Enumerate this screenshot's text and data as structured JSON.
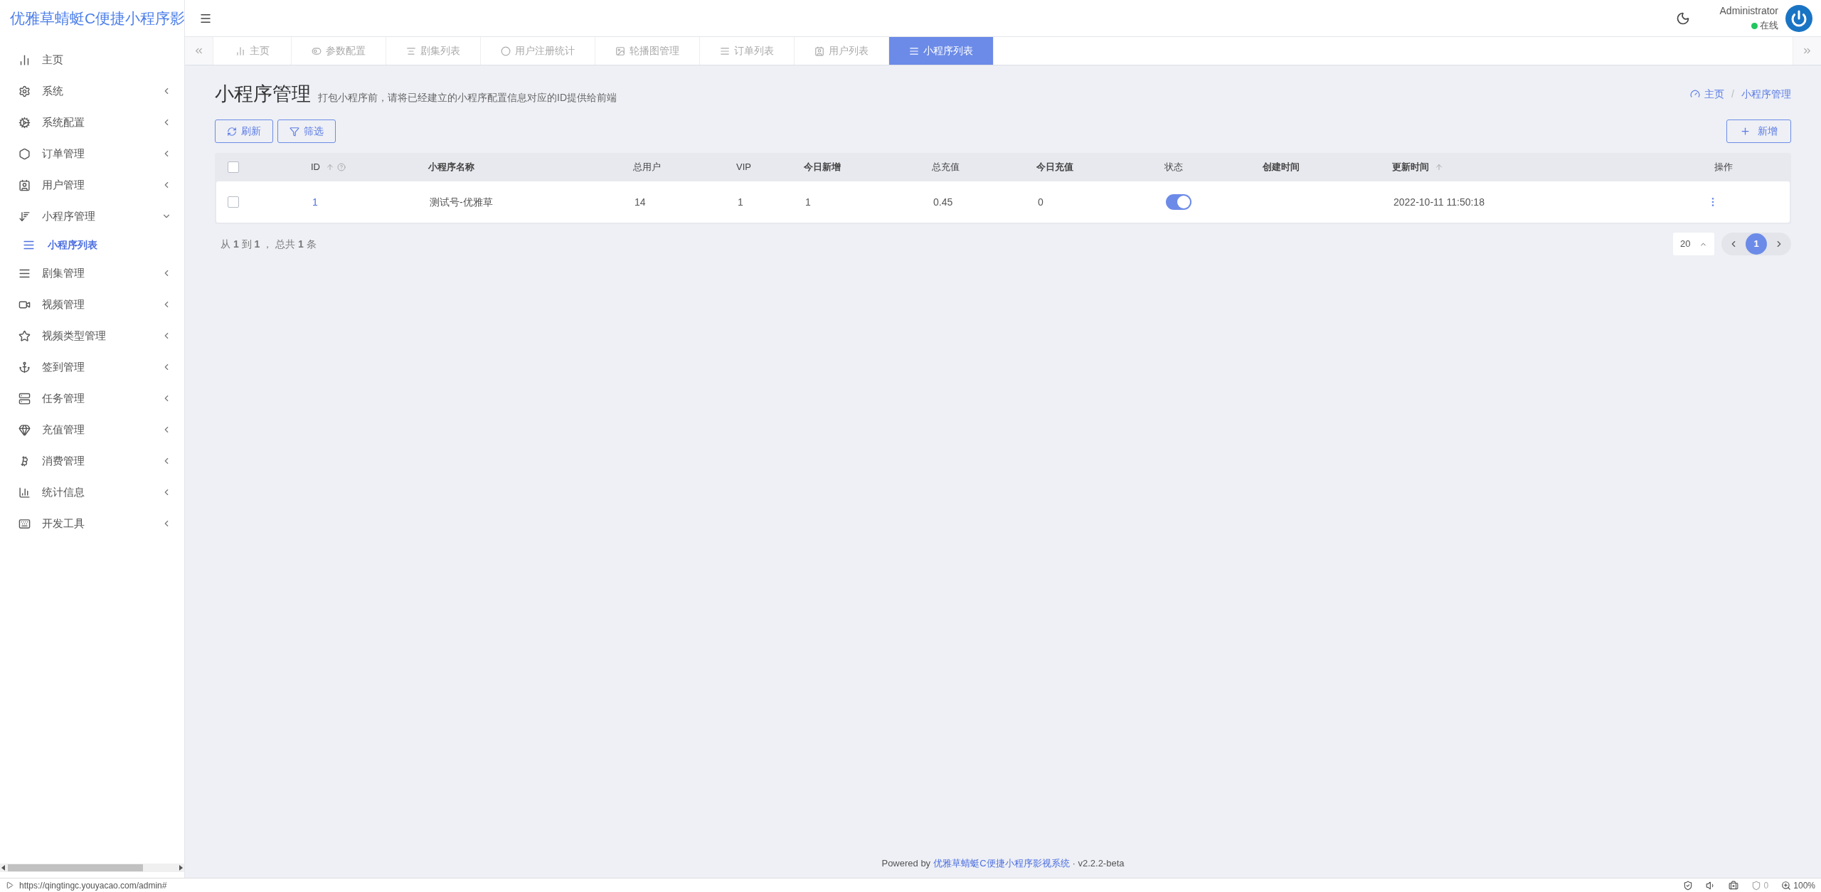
{
  "sidebar": {
    "logo": "优雅草蜻蜓C便捷小程序影",
    "items": [
      {
        "label": "主页",
        "kind": "link"
      },
      {
        "label": "系统",
        "kind": "menu",
        "expanded": false
      },
      {
        "label": "系统配置",
        "kind": "menu",
        "expanded": false
      },
      {
        "label": "订单管理",
        "kind": "menu",
        "expanded": false
      },
      {
        "label": "用户管理",
        "kind": "menu",
        "expanded": false
      },
      {
        "label": "小程序管理",
        "kind": "menu",
        "expanded": true,
        "children": [
          {
            "label": "小程序列表",
            "selected": true
          }
        ]
      },
      {
        "label": "剧集管理",
        "kind": "menu",
        "expanded": false
      },
      {
        "label": "视频管理",
        "kind": "menu",
        "expanded": false
      },
      {
        "label": "视频类型管理",
        "kind": "menu",
        "expanded": false
      },
      {
        "label": "签到管理",
        "kind": "menu",
        "expanded": false
      },
      {
        "label": "任务管理",
        "kind": "menu",
        "expanded": false
      },
      {
        "label": "充值管理",
        "kind": "menu",
        "expanded": false
      },
      {
        "label": "消费管理",
        "kind": "menu",
        "expanded": false
      },
      {
        "label": "统计信息",
        "kind": "menu",
        "expanded": false
      },
      {
        "label": "开发工具",
        "kind": "menu",
        "expanded": false
      }
    ]
  },
  "user": {
    "name": "Administrator",
    "status": "在线"
  },
  "tabs": [
    {
      "label": "主页",
      "selected": false
    },
    {
      "label": "参数配置",
      "selected": false
    },
    {
      "label": "剧集列表",
      "selected": false
    },
    {
      "label": "用户注册统计",
      "selected": false
    },
    {
      "label": "轮播图管理",
      "selected": false
    },
    {
      "label": "订单列表",
      "selected": false
    },
    {
      "label": "用户列表",
      "selected": false
    },
    {
      "label": "小程序列表",
      "selected": true
    }
  ],
  "page": {
    "title": "小程序管理",
    "subtitle": "打包小程序前，请将已经建立的小程序配置信息对应的ID提供给前端",
    "breadcrumb": [
      "主页",
      "小程序管理"
    ],
    "breadcrumb_separator": "/"
  },
  "toolbar": {
    "buttons": [
      "刷新",
      "筛选"
    ],
    "add_button": "新增"
  },
  "table": {
    "all_checked": false,
    "columns": [
      {
        "label": "ID",
        "sortable": true,
        "help": true
      },
      {
        "label": "小程序名称"
      },
      {
        "label": "总用户"
      },
      {
        "label": "VIP"
      },
      {
        "label": "今日新增"
      },
      {
        "label": "总充值"
      },
      {
        "label": "今日充值"
      },
      {
        "label": "状态"
      },
      {
        "label": "创建时间"
      },
      {
        "label": "更新时间",
        "sortable": true
      },
      {
        "label": "操作"
      }
    ],
    "rows": [
      {
        "checked": false,
        "id": "1",
        "name": "测试号-优雅草",
        "total_users": "14",
        "vip": "1",
        "today_new": "1",
        "total_recharge": "0.45",
        "today_recharge": "0",
        "status_on": true,
        "updated": "2022-10-11 11:50:18"
      }
    ]
  },
  "pagination": {
    "summary": "从 **1** 到 **1** ， 总共 **1** 条",
    "page_size": "20",
    "pages": [
      {
        "label": "1",
        "selected": true
      }
    ]
  },
  "footer": {
    "prefix": "Powered by",
    "link": "优雅草蜻蜓C便捷小程序影视系统",
    "version": "· v2.2.2-beta"
  },
  "status_bar": {
    "url": "https://qingtingc.youyacao.com/admin#",
    "ad_count": "0",
    "zoom": "100%"
  }
}
